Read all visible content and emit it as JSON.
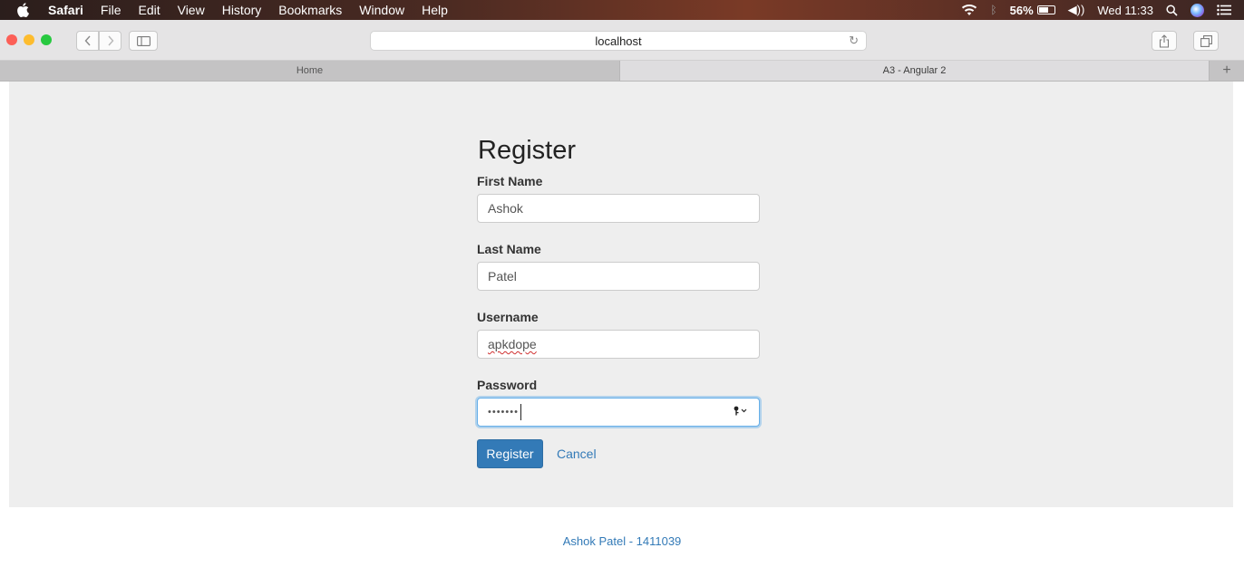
{
  "menubar": {
    "app_name": "Safari",
    "items": [
      "File",
      "Edit",
      "View",
      "History",
      "Bookmarks",
      "Window",
      "Help"
    ],
    "battery": "56%",
    "clock": "Wed 11:33"
  },
  "toolbar": {
    "url": "localhost"
  },
  "tabs": {
    "items": [
      "Home",
      "A3 - Angular 2"
    ],
    "add_label": "+"
  },
  "form": {
    "title": "Register",
    "first_name_label": "First Name",
    "first_name_value": "Ashok",
    "last_name_label": "Last Name",
    "last_name_value": "Patel",
    "username_label": "Username",
    "username_value": "apkdope",
    "password_label": "Password",
    "password_value": "•••••••",
    "submit_label": "Register",
    "cancel_label": "Cancel"
  },
  "footer": {
    "text": "Ashok Patel - 1411039"
  },
  "colors": {
    "accent": "#337ab7",
    "focus": "#66afe9",
    "traffic_red": "#fc5f57",
    "traffic_yellow": "#fdbc2e",
    "traffic_green": "#28c940"
  }
}
